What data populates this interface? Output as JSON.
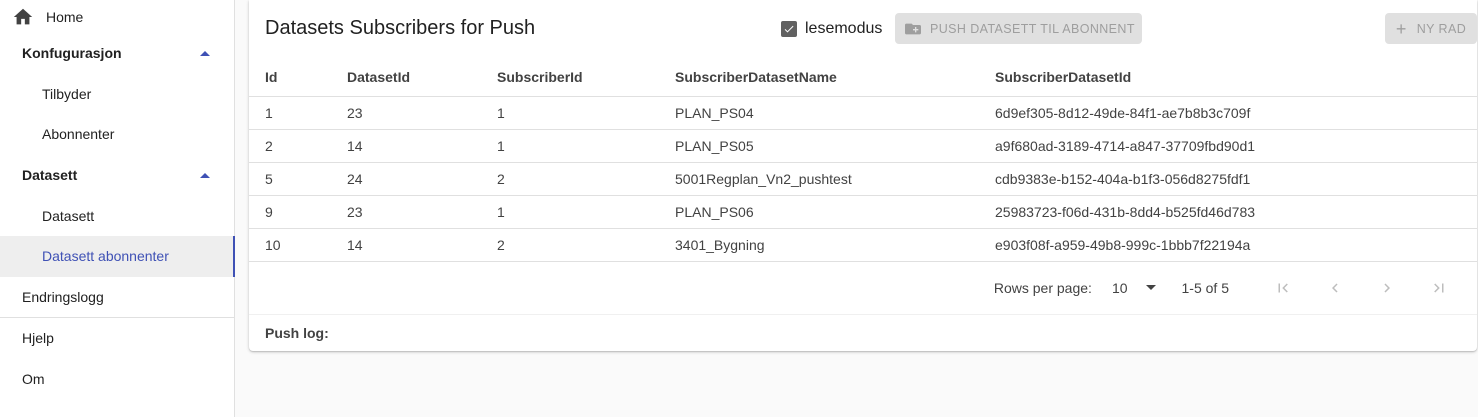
{
  "sidebar": {
    "home": "Home",
    "konfigurasjon": "Konfugurasjon",
    "tilbyder": "Tilbyder",
    "abonnenter": "Abonnenter",
    "datasett_section": "Datasett",
    "datasett": "Datasett",
    "datasett_abonnenter": "Datasett abonnenter",
    "endringslogg": "Endringslogg",
    "hjelp": "Hjelp",
    "om": "Om"
  },
  "header": {
    "title": "Datasets Subscribers for Push",
    "readmode_label": "lesemodus",
    "readmode_checked": true,
    "push_button": "PUSH DATASETT TIL ABONNENT",
    "new_row_button": "NY RAD"
  },
  "table": {
    "columns": [
      "Id",
      "DatasetId",
      "SubscriberId",
      "SubscriberDatasetName",
      "SubscriberDatasetId"
    ],
    "rows": [
      [
        "1",
        "23",
        "1",
        "PLAN_PS04",
        "6d9ef305-8d12-49de-84f1-ae7b8b3c709f"
      ],
      [
        "2",
        "14",
        "1",
        "PLAN_PS05",
        "a9f680ad-3189-4714-a847-37709fbd90d1"
      ],
      [
        "5",
        "24",
        "2",
        "5001Regplan_Vn2_pushtest",
        "cdb9383e-b152-404a-b1f3-056d8275fdf1"
      ],
      [
        "9",
        "23",
        "1",
        "PLAN_PS06",
        "25983723-f06d-431b-8dd4-b525fd46d783"
      ],
      [
        "10",
        "14",
        "2",
        "3401_Bygning",
        "e903f08f-a959-49b8-999c-1bbb7f22194a"
      ]
    ]
  },
  "pagination": {
    "rows_per_page_label": "Rows per page:",
    "rows_per_page_value": "10",
    "range": "1-5 of 5"
  },
  "pushlog": {
    "label": "Push log:"
  },
  "colors": {
    "accent": "#3f51b5",
    "disabled_bg": "#e0e0e0",
    "disabled_text": "#9e9e9e"
  }
}
